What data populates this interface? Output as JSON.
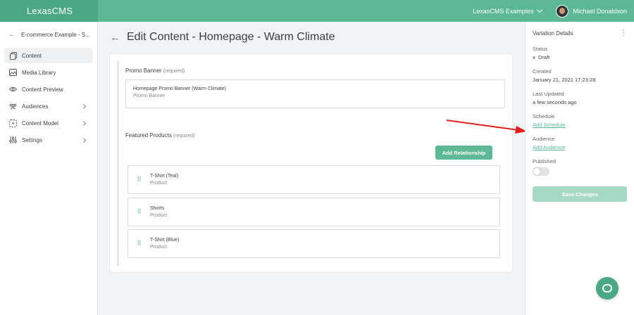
{
  "app": {
    "brand_a": "Lexas",
    "brand_b": "CMS",
    "project": "LexasCMS Examples",
    "user": "Michael Donaldson"
  },
  "sidebar": {
    "back_label": "E-commerce Example - S...",
    "items": [
      {
        "label": "Content",
        "icon": "content-icon",
        "active": true
      },
      {
        "label": "Media Library",
        "icon": "image-icon"
      },
      {
        "label": "Content Preview",
        "icon": "eye-icon"
      },
      {
        "label": "Audiences",
        "icon": "users-icon",
        "has_children": true
      },
      {
        "label": "Content Model",
        "icon": "model-icon",
        "has_children": true
      },
      {
        "label": "Settings",
        "icon": "sliders-icon",
        "has_children": true
      }
    ]
  },
  "main": {
    "title": "Edit Content - Homepage - Warm Climate",
    "promo": {
      "label": "Promo Banner",
      "required": "(required)",
      "ref_title": "Homepage Promo Banner (Warm Climate)",
      "ref_type": "Promo Banner"
    },
    "featured": {
      "label": "Featured Products",
      "required": "(required)",
      "add_button": "Add Relationship",
      "items": [
        {
          "name": "T-Shirt (Teal)",
          "type": "Product"
        },
        {
          "name": "Shorts",
          "type": "Product"
        },
        {
          "name": "T-Shirt (Blue)",
          "type": "Product"
        }
      ]
    }
  },
  "panel": {
    "title": "Variation Details",
    "status_label": "Status",
    "status_value": "Draft",
    "created_label": "Created",
    "created_value": "January 21, 2021 17:23:28",
    "updated_label": "Last Updated",
    "updated_value": "a few seconds ago",
    "schedule_label": "Schedule",
    "schedule_link": "Add Schedule",
    "audience_label": "Audience",
    "audience_link": "Add Audience",
    "published_label": "Published",
    "published": false,
    "save_button": "Save Changes"
  },
  "colors": {
    "brand": "#5cb895",
    "brand_dark": "#4aa884",
    "arrow": "#e02020"
  }
}
